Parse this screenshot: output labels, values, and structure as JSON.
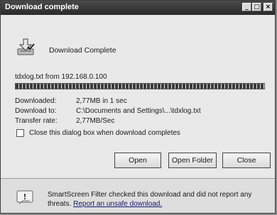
{
  "window": {
    "title": "Download complete",
    "controls": {
      "minimize": "_",
      "maximize": "□",
      "close": "×"
    }
  },
  "header": {
    "title": "Download Complete",
    "icon": "download-complete-icon"
  },
  "download": {
    "source": "tdxlog.txt from 192.168.0.100",
    "progress_fraction": 1.0,
    "rows": [
      {
        "label": "Downloaded:",
        "value": "2,77MB in 1 sec"
      },
      {
        "label": "Download to:",
        "value": "C:\\Documents and Settings\\...\\tdxlog.txt"
      },
      {
        "label": "Transfer rate:",
        "value": "2,77MB/Sec"
      }
    ],
    "close_on_complete": {
      "label": "Close this dialog box when download completes",
      "checked": false
    }
  },
  "buttons": {
    "open": "Open",
    "open_folder": "Open Folder",
    "close": "Close"
  },
  "footer": {
    "icon": "smartscreen-shield-icon",
    "text": "SmartScreen Filter checked this download and did not report any threats.",
    "link": "Report an unsafe download."
  }
}
